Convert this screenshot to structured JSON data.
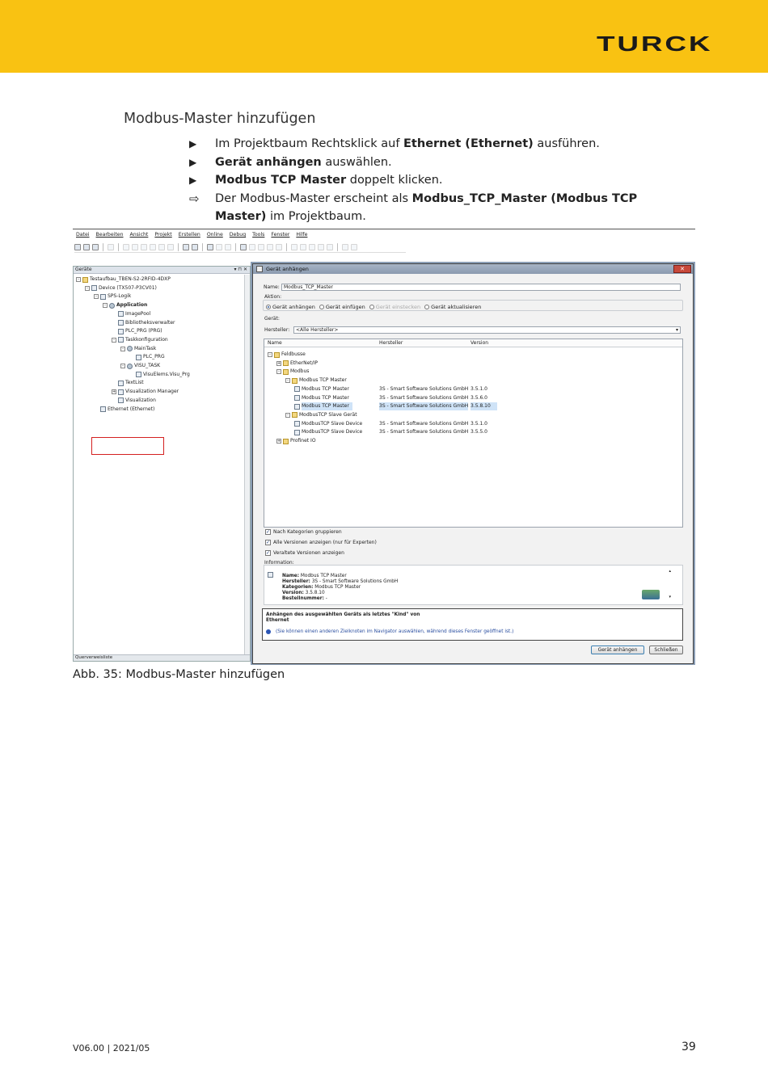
{
  "header": {
    "logo": "TURCK",
    "color": "#f9c212"
  },
  "section": {
    "title": "Modbus-Master hinzufügen"
  },
  "steps": [
    {
      "marker": "▶",
      "parts": [
        "Im Projektbaum Rechtsklick auf ",
        "Ethernet (Ethernet)",
        " ausführen."
      ]
    },
    {
      "marker": "▶",
      "parts": [
        "",
        "Gerät anhängen",
        " auswählen."
      ]
    },
    {
      "marker": "▶",
      "parts": [
        "",
        "Modbus TCP Master",
        " doppelt klicken."
      ]
    },
    {
      "marker": "⇨",
      "parts": [
        "Der Modbus-Master erscheint als ",
        "Modbus_TCP_Master (Modbus TCP Master)",
        " im Projektbaum."
      ]
    }
  ],
  "screenshot": {
    "menu": [
      "Datei",
      "Bearbeiten",
      "Ansicht",
      "Projekt",
      "Erstellen",
      "Online",
      "Debug",
      "Tools",
      "Fenster",
      "Hilfe"
    ],
    "panel": {
      "title": "Geräte",
      "footer": "Querverweisliste",
      "tree": [
        {
          "label": "Testaufbau_TBEN-S2-2RFID-4DXP",
          "indent": 0,
          "icon": "folder",
          "exp": "-"
        },
        {
          "label": "Device (TX507-P3CV01)",
          "indent": 1,
          "icon": "device",
          "exp": "-"
        },
        {
          "label": "SPS-Logik",
          "indent": 2,
          "icon": "plc",
          "exp": "-"
        },
        {
          "label": "Application",
          "indent": 3,
          "icon": "gear",
          "exp": "-",
          "bold": true
        },
        {
          "label": "ImagePool",
          "indent": 4,
          "icon": "file"
        },
        {
          "label": "Bibliotheksverwalter",
          "indent": 4,
          "icon": "file"
        },
        {
          "label": "PLC_PRG (PRG)",
          "indent": 4,
          "icon": "file"
        },
        {
          "label": "Taskkonfiguration",
          "indent": 4,
          "icon": "file",
          "exp": "-"
        },
        {
          "label": "MainTask",
          "indent": 5,
          "icon": "gear",
          "exp": "-"
        },
        {
          "label": "PLC_PRG",
          "indent": 6,
          "icon": "file"
        },
        {
          "label": "VISU_TASK",
          "indent": 5,
          "icon": "gear",
          "exp": "-"
        },
        {
          "label": "VisuElems.Visu_Prg",
          "indent": 6,
          "icon": "file"
        },
        {
          "label": "TextList",
          "indent": 4,
          "icon": "file"
        },
        {
          "label": "Visualization Manager",
          "indent": 4,
          "icon": "file",
          "exp": "+"
        },
        {
          "label": "Visualization",
          "indent": 4,
          "icon": "file"
        },
        {
          "label": "Ethernet (Ethernet)",
          "indent": 2,
          "icon": "device"
        }
      ]
    },
    "dialog": {
      "title": "Gerät anhängen",
      "name_label": "Name:",
      "name_value": "Modbus_TCP_Master",
      "action_label": "Aktion:",
      "actions": [
        {
          "label": "Gerät anhängen",
          "selected": true,
          "disabled": false
        },
        {
          "label": "Gerät einfügen",
          "selected": false,
          "disabled": false
        },
        {
          "label": "Gerät einstecken",
          "selected": false,
          "disabled": true
        },
        {
          "label": "Gerät aktualisieren",
          "selected": false,
          "disabled": false
        }
      ],
      "device_label": "Gerät:",
      "vendor_label": "Hersteller:",
      "vendor_value": "<Alle Hersteller>",
      "columns": [
        "Name",
        "Hersteller",
        "Version"
      ],
      "rows": [
        {
          "name": "Feldbusse",
          "vendor": "",
          "version": "",
          "indent": 0,
          "exp": "-"
        },
        {
          "name": "EtherNet/IP",
          "vendor": "",
          "version": "",
          "indent": 1,
          "exp": "+"
        },
        {
          "name": "Modbus",
          "vendor": "",
          "version": "",
          "indent": 1,
          "exp": "-"
        },
        {
          "name": "Modbus TCP Master",
          "vendor": "",
          "version": "",
          "indent": 2,
          "exp": "-"
        },
        {
          "name": "Modbus TCP Master",
          "vendor": "3S - Smart Software Solutions GmbH",
          "version": "3.5.1.0",
          "indent": 3
        },
        {
          "name": "Modbus TCP Master",
          "vendor": "3S - Smart Software Solutions GmbH",
          "version": "3.5.6.0",
          "indent": 3
        },
        {
          "name": "Modbus TCP Master",
          "vendor": "3S - Smart Software Solutions GmbH",
          "version": "3.5.8.10",
          "indent": 3,
          "selected": true
        },
        {
          "name": "ModbusTCP Slave Gerät",
          "vendor": "",
          "version": "",
          "indent": 2,
          "exp": "-"
        },
        {
          "name": "ModbusTCP Slave Device",
          "vendor": "3S - Smart Software Solutions GmbH",
          "version": "3.5.1.0",
          "indent": 3
        },
        {
          "name": "ModbusTCP Slave Device",
          "vendor": "3S - Smart Software Solutions GmbH",
          "version": "3.5.5.0",
          "indent": 3
        },
        {
          "name": "Profinet IO",
          "vendor": "",
          "version": "",
          "indent": 1,
          "exp": "+"
        }
      ],
      "checkboxes": [
        {
          "label": "Nach Kategorien gruppieren",
          "checked": true
        },
        {
          "label": "Alle Versionen anzeigen (nur für Experten)",
          "checked": true
        },
        {
          "label": "Veraltete Versionen anzeigen",
          "checked": true
        }
      ],
      "info_label": "Information:",
      "info": [
        {
          "key": "Name:",
          "value": " Modbus TCP Master"
        },
        {
          "key": "Hersteller:",
          "value": " 3S - Smart Software Solutions GmbH"
        },
        {
          "key": "Kategorien:",
          "value": " Modbus TCP Master"
        },
        {
          "key": "Version:",
          "value": " 3.5.8.10"
        },
        {
          "key": "Bestellnummer:",
          "value": " -"
        }
      ],
      "note_title": "Anhängen des ausgewählten Geräts als letztes \"Kind\" von",
      "note_target": "Ethernet",
      "note_hint": "(Sie können einen anderen Zielknoten im Navigator auswählen, während dieses Fenster geöffnet ist.)",
      "btn_attach": "Gerät anhängen",
      "btn_close": "Schließen"
    }
  },
  "caption": "Abb. 35: Modbus-Master hinzufügen",
  "footer": {
    "version": "V06.00 | 2021/05",
    "page": "39"
  }
}
